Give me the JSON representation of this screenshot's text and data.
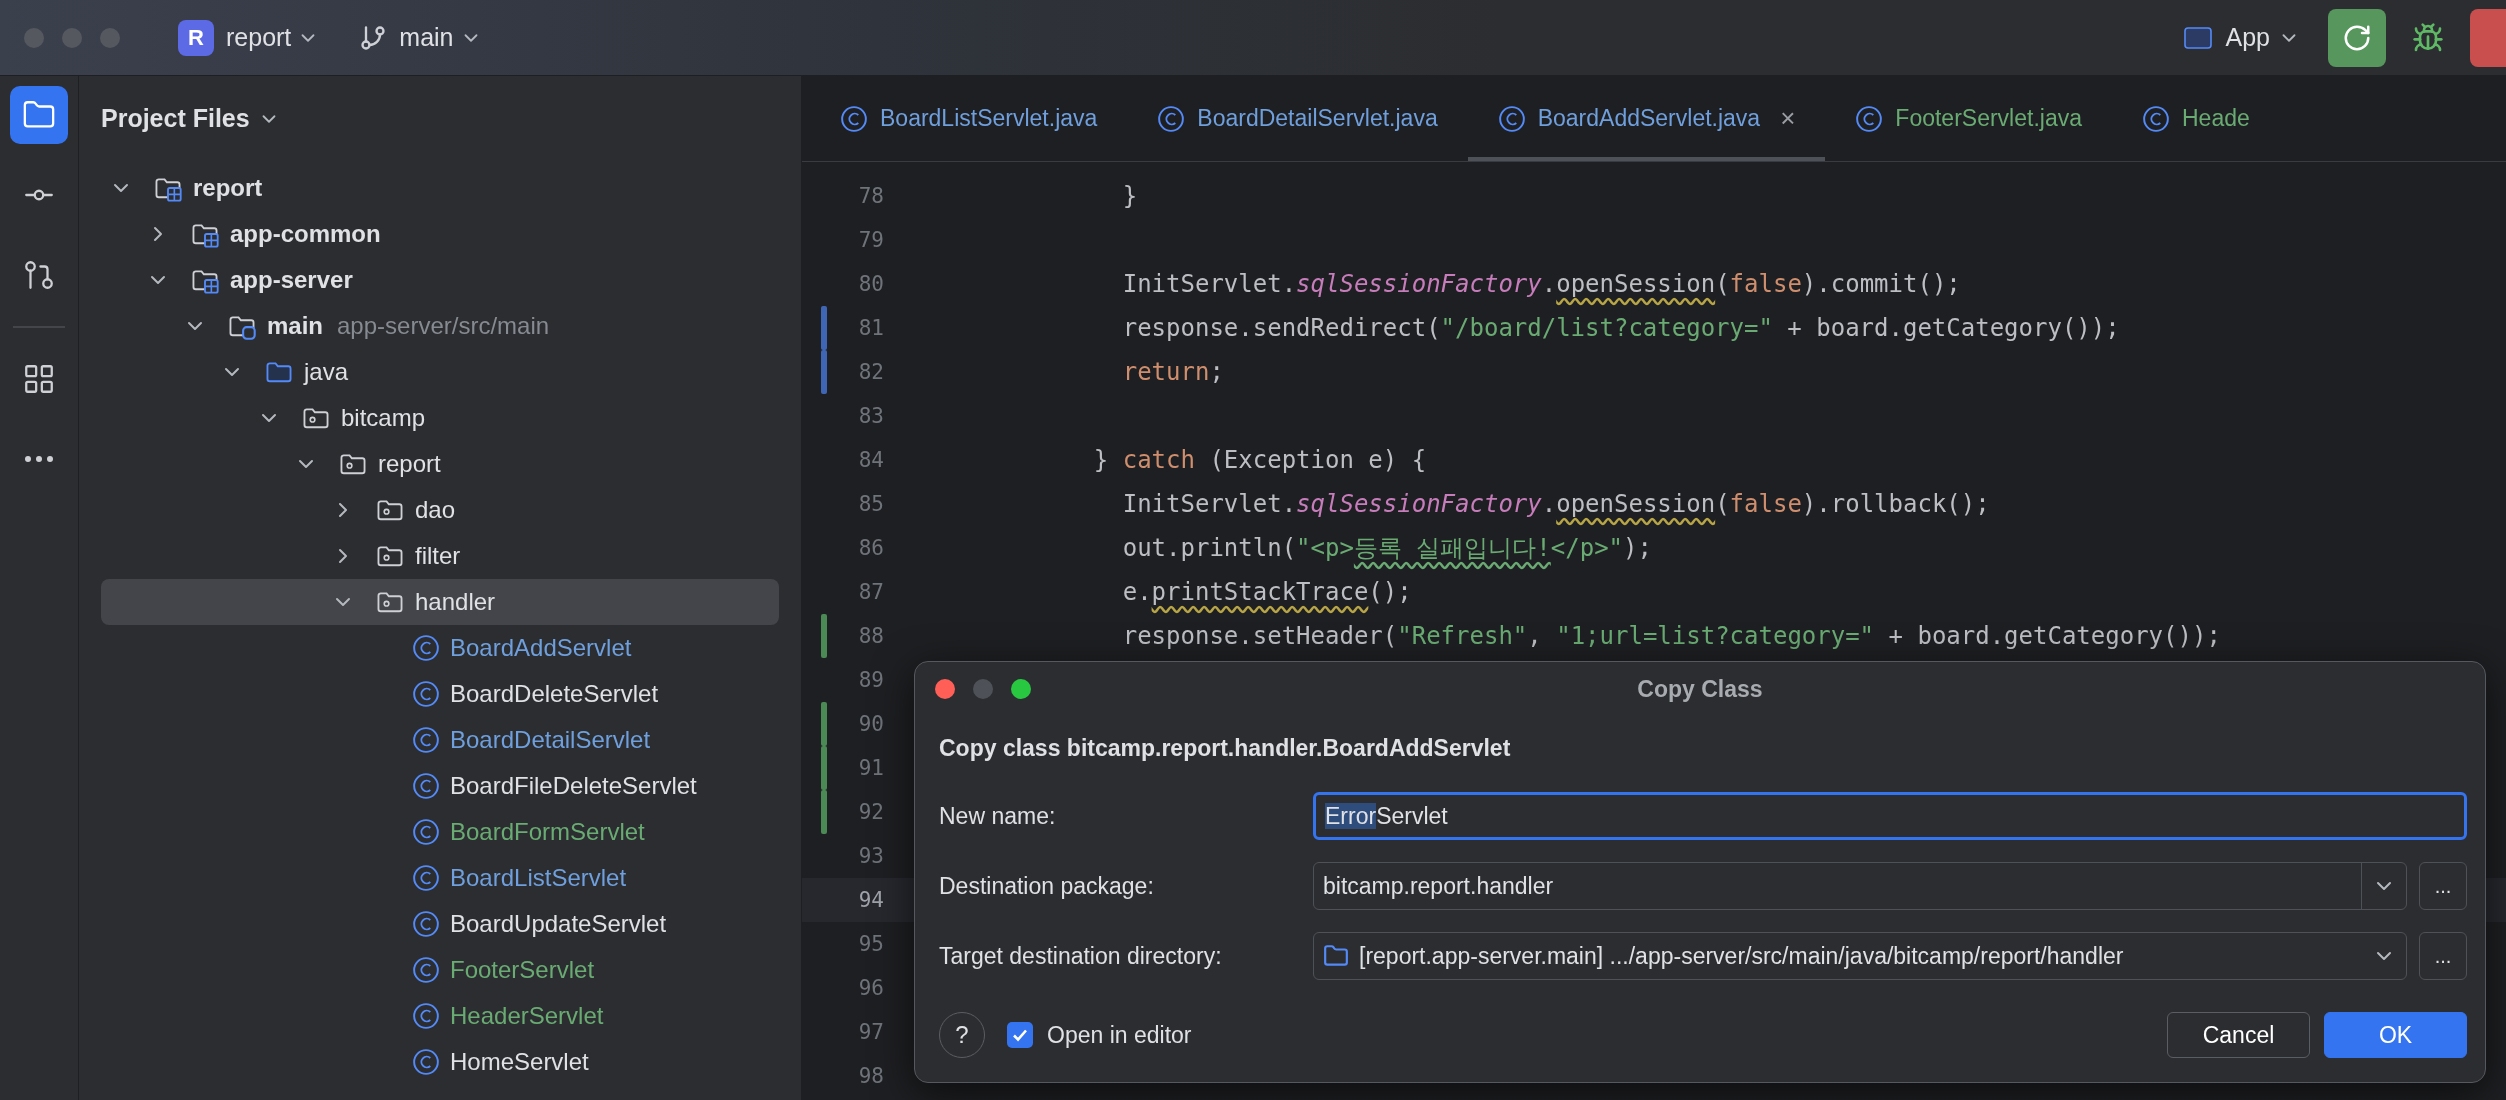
{
  "title_bar": {
    "project_badge": "R",
    "project": "report",
    "branch": "main",
    "run_config": "App"
  },
  "tool_strip": [
    {
      "kind": "project",
      "selected": true
    },
    {
      "kind": "commit",
      "selected": false
    },
    {
      "kind": "pull-requests",
      "selected": false
    },
    {
      "kind": "structure",
      "selected": false,
      "separated_above": true
    },
    {
      "kind": "more",
      "selected": false
    }
  ],
  "project_panel": {
    "title": "Project Files",
    "tree": [
      {
        "label": "report",
        "kind": "module",
        "expanded": true,
        "selected": false,
        "children": [
          {
            "label": "app-common",
            "kind": "module",
            "expanded": false,
            "selected": false
          },
          {
            "label": "app-server",
            "kind": "module",
            "expanded": true,
            "selected": false,
            "children": [
              {
                "label": "main",
                "hint": "app-server/src/main",
                "kind": "source-set",
                "expanded": true,
                "selected": false,
                "children": [
                  {
                    "label": "java",
                    "kind": "source-root",
                    "expanded": true,
                    "selected": false,
                    "children": [
                      {
                        "label": "bitcamp",
                        "kind": "package",
                        "expanded": true,
                        "selected": false,
                        "children": [
                          {
                            "label": "report",
                            "kind": "package",
                            "expanded": true,
                            "selected": false,
                            "children": [
                              {
                                "label": "dao",
                                "kind": "package",
                                "expanded": false,
                                "selected": false
                              },
                              {
                                "label": "filter",
                                "kind": "package",
                                "expanded": false,
                                "selected": false
                              },
                              {
                                "label": "handler",
                                "kind": "package",
                                "expanded": true,
                                "selected": true,
                                "children": [
                                  {
                                    "label": "BoardAddServlet",
                                    "kind": "class",
                                    "color": "#6f9fdc",
                                    "selected": false
                                  },
                                  {
                                    "label": "BoardDeleteServlet",
                                    "kind": "class",
                                    "color": "#dfe1e5",
                                    "selected": false
                                  },
                                  {
                                    "label": "BoardDetailServlet",
                                    "kind": "class",
                                    "color": "#6f9fdc",
                                    "selected": false
                                  },
                                  {
                                    "label": "BoardFileDeleteServlet",
                                    "kind": "class",
                                    "color": "#dfe1e5",
                                    "selected": false
                                  },
                                  {
                                    "label": "BoardFormServlet",
                                    "kind": "class",
                                    "color": "#6aab73",
                                    "selected": false
                                  },
                                  {
                                    "label": "BoardListServlet",
                                    "kind": "class",
                                    "color": "#6f9fdc",
                                    "selected": false
                                  },
                                  {
                                    "label": "BoardUpdateServlet",
                                    "kind": "class",
                                    "color": "#dfe1e5",
                                    "selected": false
                                  },
                                  {
                                    "label": "FooterServlet",
                                    "kind": "class",
                                    "color": "#6aab73",
                                    "selected": false
                                  },
                                  {
                                    "label": "HeaderServlet",
                                    "kind": "class",
                                    "color": "#6aab73",
                                    "selected": false
                                  },
                                  {
                                    "label": "HomeServlet",
                                    "kind": "class",
                                    "color": "#dfe1e5",
                                    "selected": false
                                  }
                                ]
                              }
                            ]
                          }
                        ]
                      }
                    ]
                  }
                ]
              }
            ]
          }
        ]
      }
    ]
  },
  "editor": {
    "tabs": [
      {
        "label": "BoardListServlet.java",
        "color": "#6f9fdc",
        "selected": false
      },
      {
        "label": "BoardDetailServlet.java",
        "color": "#6f9fdc",
        "selected": false
      },
      {
        "label": "BoardAddServlet.java",
        "color": "#6f9fdc",
        "selected": true,
        "close": "×"
      },
      {
        "label": "FooterServlet.java",
        "color": "#6aab73",
        "selected": false
      },
      {
        "label": "Heade",
        "color": "#6aab73",
        "selected": false
      }
    ],
    "lines": [
      {
        "number": "78",
        "tokens": [
          {
            "kind": "text",
            "text": "      }"
          }
        ]
      },
      {
        "number": "79"
      },
      {
        "number": "80",
        "tokens": [
          {
            "kind": "text",
            "text": "      InitServlet."
          },
          {
            "kind": "field",
            "text": "sqlSessionFactory"
          },
          {
            "kind": "text",
            "text": "."
          },
          {
            "kind": "typo",
            "text": "openSession"
          },
          {
            "kind": "text",
            "text": "("
          },
          {
            "kind": "keyword",
            "text": "false"
          },
          {
            "kind": "text",
            "text": ").commit();"
          }
        ]
      },
      {
        "number": "81",
        "color": "#3f66b4",
        "tokens": [
          {
            "kind": "text",
            "text": "      response.sendRedirect("
          },
          {
            "kind": "string",
            "text": "\"/board/list?category=\""
          },
          {
            "kind": "text",
            "text": " + board.getCategory());"
          }
        ]
      },
      {
        "number": "82",
        "color": "#3f66b4",
        "tokens": [
          {
            "kind": "keyword",
            "text": "      return"
          },
          {
            "kind": "text",
            "text": ";"
          }
        ]
      },
      {
        "number": "83"
      },
      {
        "number": "84",
        "tokens": [
          {
            "kind": "text",
            "text": "    } "
          },
          {
            "kind": "keyword",
            "text": "catch"
          },
          {
            "kind": "text",
            "text": " (Exception e) {"
          }
        ]
      },
      {
        "number": "85",
        "tokens": [
          {
            "kind": "text",
            "text": "      InitServlet."
          },
          {
            "kind": "field",
            "text": "sqlSessionFactory"
          },
          {
            "kind": "text",
            "text": "."
          },
          {
            "kind": "typo",
            "text": "openSession"
          },
          {
            "kind": "text",
            "text": "("
          },
          {
            "kind": "keyword",
            "text": "false"
          },
          {
            "kind": "text",
            "text": ").rollback();"
          }
        ]
      },
      {
        "number": "86",
        "tokens": [
          {
            "kind": "text",
            "text": "      out.println("
          },
          {
            "kind": "string",
            "text": "\"<p>"
          },
          {
            "kind": "string-typo",
            "text": "등록 실패입니다!"
          },
          {
            "kind": "string",
            "text": "</p>\""
          },
          {
            "kind": "text",
            "text": ");"
          }
        ]
      },
      {
        "number": "87",
        "tokens": [
          {
            "kind": "text",
            "text": "      e."
          },
          {
            "kind": "typo",
            "text": "printStackTrace"
          },
          {
            "kind": "text",
            "text": "();"
          }
        ]
      },
      {
        "number": "88",
        "color": "#4b8a55",
        "tokens": [
          {
            "kind": "text",
            "text": "      response.setHeader("
          },
          {
            "kind": "string",
            "text": "\"Refresh\""
          },
          {
            "kind": "text",
            "text": ", "
          },
          {
            "kind": "string",
            "text": "\"1;url=list?category=\""
          },
          {
            "kind": "text",
            "text": " + board.getCategory());"
          }
        ]
      },
      {
        "number": "89"
      },
      {
        "number": "90",
        "color": "#4b8a55"
      },
      {
        "number": "91",
        "color": "#4b8a55"
      },
      {
        "number": "92",
        "color": "#4b8a55"
      },
      {
        "number": "93"
      },
      {
        "number": "94",
        "current": true
      },
      {
        "number": "95"
      },
      {
        "number": "96"
      },
      {
        "number": "97"
      },
      {
        "number": "98"
      }
    ]
  },
  "dialog": {
    "title": "Copy Class",
    "heading": "Copy class bitcamp.report.handler.BoardAddServlet",
    "fields": [
      {
        "kind": "text",
        "label": "New name:",
        "value_parts": [
          {
            "text": "Error",
            "selected": true
          },
          {
            "text": "Servlet",
            "selected": false
          }
        ],
        "focused": true
      },
      {
        "kind": "combo",
        "label": "Destination package:",
        "value": "bitcamp.report.handler",
        "browse_button": "...",
        "focused": false
      },
      {
        "kind": "directory",
        "label": "Target destination directory:",
        "value": "[report.app-server.main] .../app-server/src/main/java/bitcamp/report/handler",
        "browse_button": "...",
        "focused": false
      }
    ],
    "help_button": "?",
    "checkbox": {
      "label": "Open in editor",
      "checked": true
    },
    "buttons": [
      {
        "label": "Cancel",
        "default": false
      },
      {
        "label": "OK",
        "default": true
      }
    ]
  }
}
